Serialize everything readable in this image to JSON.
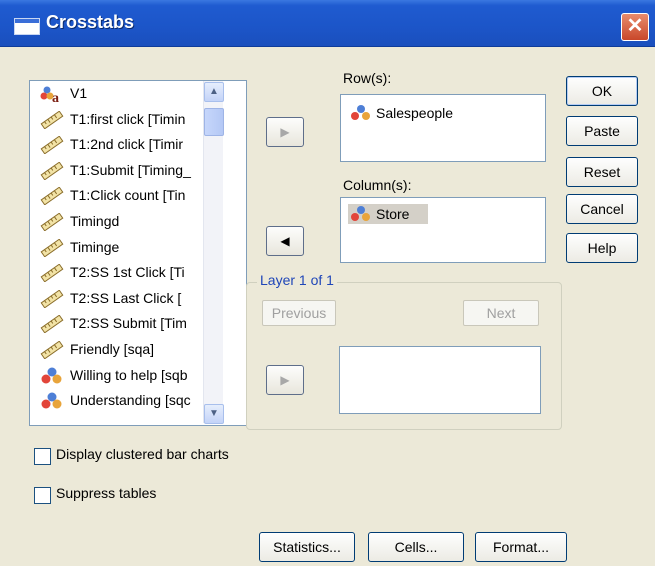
{
  "window": {
    "title": "Crosstabs",
    "close_label": "✕"
  },
  "variables": [
    {
      "label": "V1",
      "icon": "nominal-string-icon"
    },
    {
      "label": "T1:first click [Timin",
      "icon": "scale-ruler-icon"
    },
    {
      "label": "T1:2nd click [Timir",
      "icon": "scale-ruler-icon"
    },
    {
      "label": "T1:Submit [Timing_",
      "icon": "scale-ruler-icon"
    },
    {
      "label": "T1:Click count [Tin",
      "icon": "scale-ruler-icon"
    },
    {
      "label": "Timingd",
      "icon": "scale-ruler-icon"
    },
    {
      "label": "Timinge",
      "icon": "scale-ruler-icon"
    },
    {
      "label": "T2:SS 1st Click [Ti",
      "icon": "scale-ruler-icon"
    },
    {
      "label": "T2:SS Last Click [",
      "icon": "scale-ruler-icon"
    },
    {
      "label": "T2:SS Submit [Tim",
      "icon": "scale-ruler-icon"
    },
    {
      "label": "Friendly [sqa]",
      "icon": "scale-ruler-icon"
    },
    {
      "label": "Willing to help [sqb",
      "icon": "nominal-icon"
    },
    {
      "label": "Understanding [sqc",
      "icon": "nominal-icon"
    }
  ],
  "rows": {
    "label": "Row(s):",
    "items": [
      "Salespeople"
    ]
  },
  "columns": {
    "label": "Column(s):",
    "items": [
      "Store"
    ]
  },
  "layer": {
    "title": "Layer 1 of 1",
    "previous": "Previous",
    "next": "Next"
  },
  "buttons": {
    "ok": "OK",
    "paste": "Paste",
    "reset": "Reset",
    "cancel": "Cancel",
    "help": "Help"
  },
  "options": {
    "clustered": "Display clustered bar charts",
    "suppress": "Suppress tables"
  },
  "bottom_buttons": {
    "statistics": "Statistics...",
    "cells": "Cells...",
    "format": "Format..."
  },
  "arrows": {
    "right": "▶",
    "left": "◀",
    "up": "▲",
    "down": "▼"
  }
}
